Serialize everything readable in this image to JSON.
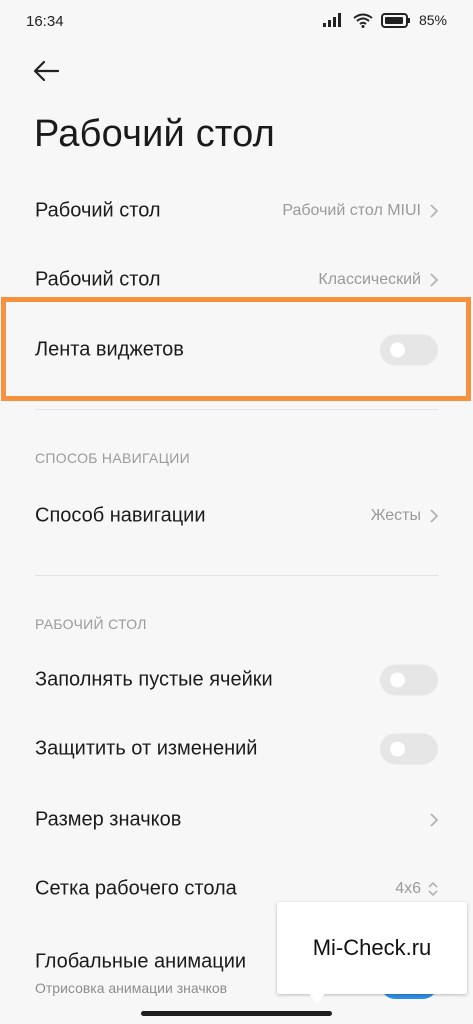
{
  "status_bar": {
    "time": "16:34",
    "battery": "85%"
  },
  "header": {
    "back_icon": "arrow-left-icon",
    "title": "Рабочий стол"
  },
  "rows_top": [
    {
      "label": "Рабочий стол",
      "value": "Рабочий стол MIUI"
    },
    {
      "label": "Рабочий стол",
      "value": "Классический"
    },
    {
      "label": "Лента виджетов",
      "toggle": false
    }
  ],
  "section_navigation": {
    "header": "СПОСОБ НАВИГАЦИИ",
    "row": {
      "label": "Способ навигации",
      "value": "Жесты"
    }
  },
  "section_desktop": {
    "header": "РАБОЧИЙ СТОЛ",
    "rows": [
      {
        "label": "Заполнять пустые ячейки",
        "toggle": false
      },
      {
        "label": "Защитить от изменений",
        "toggle": false
      },
      {
        "label": "Размер значков"
      },
      {
        "label": "Сетка рабочего стола",
        "value": "4x6"
      },
      {
        "label": "Глобальные анимации",
        "sublabel": "Отрисовка анимации значков",
        "toggle": true
      }
    ]
  },
  "watermark": {
    "text": "Mi-Check.ru"
  },
  "colors": {
    "highlight": "#f7913d",
    "toggle_on": "#2f8fe8",
    "toggle_off": "#e6e6e6"
  }
}
